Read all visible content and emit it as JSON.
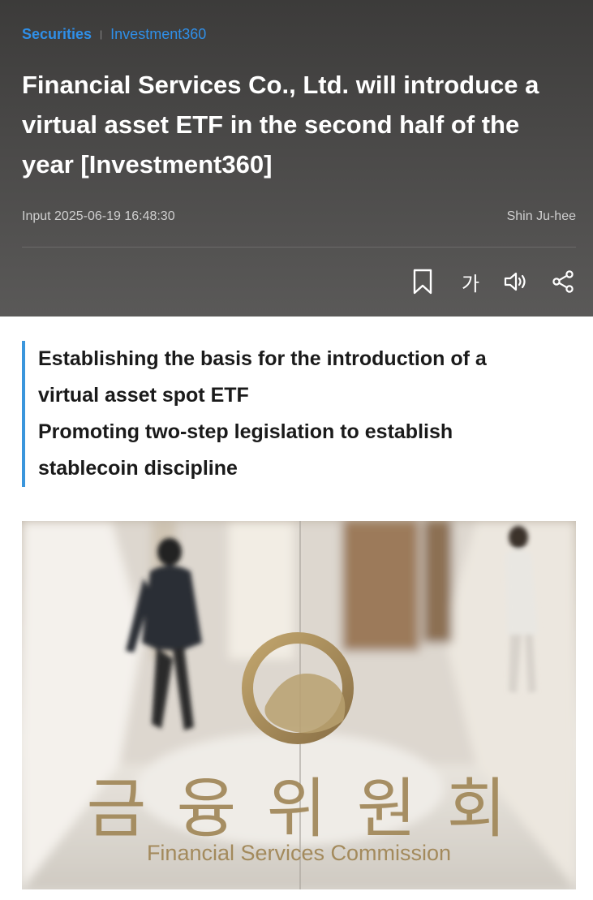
{
  "breadcrumb": {
    "section": "Securities",
    "separator": "|",
    "series": "Investment360"
  },
  "article": {
    "headline_lines": [
      "Financial Services Co., Ltd. will introduce a",
      "virtual asset ETF in the second half of the",
      "year [Investment360]"
    ],
    "input_time": "Input 2025-06-19 16:48:30",
    "author": "Shin Ju-hee",
    "summary_lines": [
      "Establishing the basis for the introduction of a",
      "virtual asset spot ETF",
      "Promoting two-step legislation to establish",
      "stablecoin discipline"
    ]
  },
  "toolbar": {
    "font_size_label": "가"
  },
  "photo": {
    "sign_korean": "금 융 위 원 회",
    "sign_english": "Financial Services Commission"
  },
  "colors": {
    "accent_blue": "#2f8fe8",
    "summary_bar": "#3a96dc",
    "hero_background": "#464544",
    "emblem_gold": "#a38a5c"
  },
  "icons": [
    "bookmark-icon",
    "font-size-icon",
    "speaker-icon",
    "share-icon"
  ]
}
